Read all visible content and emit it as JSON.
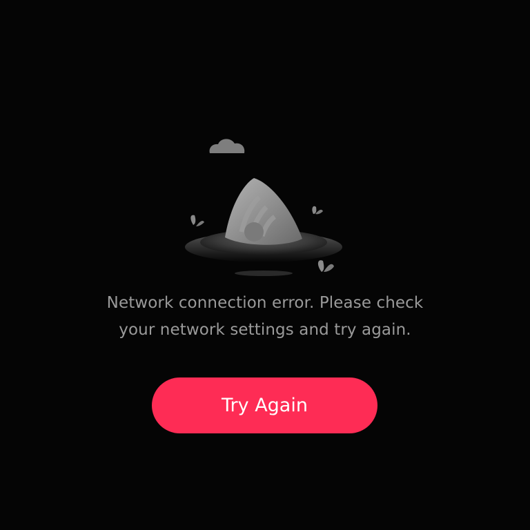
{
  "error": {
    "message_line1": "Network connection error. Please check",
    "message_line2": "your network settings and try again.",
    "illustration_icon": "wifi-sinking-in-hole-illustration"
  },
  "actions": {
    "retry_label": "Try Again"
  },
  "colors": {
    "background": "#050505",
    "accent": "#fe2c55",
    "message_text": "#9a9a9a",
    "button_text": "#ffffff",
    "illustration_gray": "#8a8a8a"
  },
  "icons": {
    "cloud": "cloud-icon",
    "wifi": "wifi-icon",
    "leaf": "leaf-icon"
  }
}
